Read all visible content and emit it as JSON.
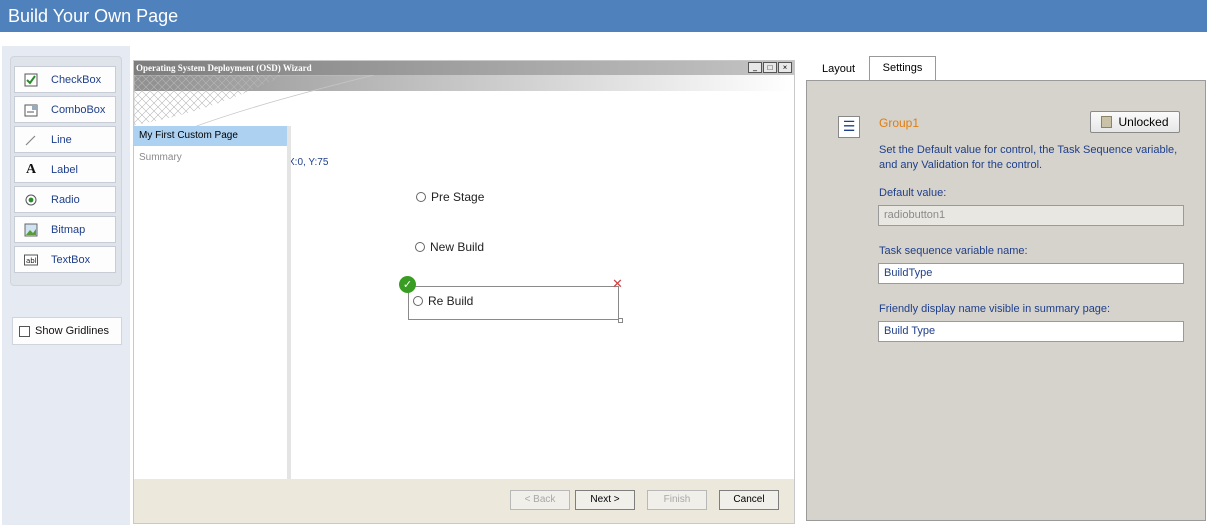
{
  "app": {
    "title": "Build Your Own Page"
  },
  "toolbox": {
    "items": [
      {
        "label": "CheckBox",
        "icon": "checkbox-icon"
      },
      {
        "label": "ComboBox",
        "icon": "combobox-icon"
      },
      {
        "label": "Line",
        "icon": "line-icon"
      },
      {
        "label": "Label",
        "icon": "label-icon"
      },
      {
        "label": "Radio",
        "icon": "radio-icon"
      },
      {
        "label": "Bitmap",
        "icon": "bitmap-icon"
      },
      {
        "label": "TextBox",
        "icon": "textbox-icon"
      }
    ],
    "show_gridlines": {
      "label": "Show Gridlines",
      "checked": false
    }
  },
  "wizard": {
    "caption": "Operating System Deployment (OSD) Wizard",
    "coords": "X:0, Y:75",
    "nav": [
      {
        "label": "My First Custom Page",
        "selected": true
      },
      {
        "label": "Summary",
        "selected": false
      }
    ],
    "radios": [
      {
        "label": "Pre Stage"
      },
      {
        "label": "New Build"
      },
      {
        "label": "Re Build"
      }
    ],
    "buttons": {
      "back": "< Back",
      "next": "Next >",
      "finish": "Finish",
      "cancel": "Cancel"
    }
  },
  "panel": {
    "tabs": [
      {
        "label": "Layout"
      },
      {
        "label": "Settings",
        "active": true
      }
    ],
    "group_name": "Group1",
    "lock_label": "Unlocked",
    "description": "Set the Default value for control, the Task Sequence variable, and any Validation for the control.",
    "default_value": {
      "label": "Default value:",
      "value": "radiobutton1"
    },
    "ts_variable": {
      "label": "Task sequence variable name:",
      "value": "BuildType"
    },
    "friendly_name": {
      "label": "Friendly display name visible in summary page:",
      "value": "Build Type"
    }
  },
  "colors": {
    "title_bar": "#4f81bd",
    "accent_text": "#1f3f8a",
    "group_orange": "#e07d10",
    "nav_selected": "#add1f1",
    "panel_bg": "#d6d3cd"
  }
}
